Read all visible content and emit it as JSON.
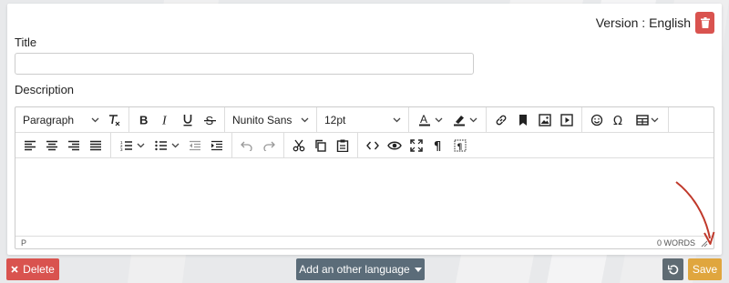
{
  "header": {
    "version_label": "Version : English"
  },
  "form": {
    "title_label": "Title",
    "title_value": "",
    "title_placeholder": "",
    "description_label": "Description"
  },
  "editor": {
    "block_format": "Paragraph",
    "font_family": "Nunito Sans",
    "font_size": "12pt",
    "status_path": "P",
    "word_count": "0 WORDS"
  },
  "footer": {
    "delete_label": "Delete",
    "add_language_label": "Add an other language",
    "save_label": "Save"
  },
  "colors": {
    "danger": "#d9534f",
    "secondary": "#5b6c79",
    "warning": "#e0a63e",
    "annotation_arrow": "#c0392b"
  },
  "icons": {
    "toolbar_row1": [
      "clear-formatting-icon",
      "bold-icon",
      "italic-icon",
      "underline-icon",
      "strikethrough-icon",
      "text-color-icon",
      "highlight-color-icon",
      "link-icon",
      "bookmark-icon",
      "image-icon",
      "media-icon",
      "emoticon-icon",
      "omega-icon",
      "table-icon"
    ],
    "toolbar_row2": [
      "align-left-icon",
      "align-center-icon",
      "align-right-icon",
      "align-justify-icon",
      "numbered-list-icon",
      "bullet-list-icon",
      "outdent-icon",
      "indent-icon",
      "undo-icon",
      "redo-icon",
      "cut-icon",
      "copy-icon",
      "paste-icon",
      "code-icon",
      "preview-icon",
      "fullscreen-icon",
      "pilcrow-icon",
      "show-blocks-icon"
    ]
  }
}
